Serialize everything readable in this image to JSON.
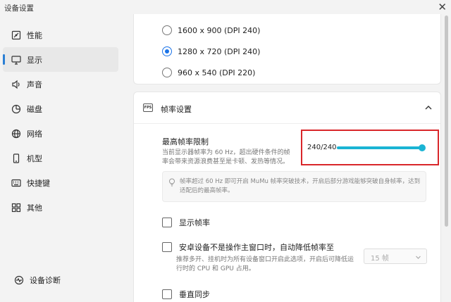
{
  "window": {
    "title": "设备设置",
    "close_glyph": "✕"
  },
  "sidebar": {
    "items": [
      {
        "label": "性能",
        "icon": "speedometer-icon",
        "active": false
      },
      {
        "label": "显示",
        "icon": "monitor-icon",
        "active": true
      },
      {
        "label": "声音",
        "icon": "speaker-icon",
        "active": false
      },
      {
        "label": "磁盘",
        "icon": "disk-icon",
        "active": false
      },
      {
        "label": "网络",
        "icon": "globe-icon",
        "active": false
      },
      {
        "label": "机型",
        "icon": "phone-icon",
        "active": false
      },
      {
        "label": "快捷键",
        "icon": "keyboard-icon",
        "active": false
      },
      {
        "label": "其他",
        "icon": "grid-icon",
        "active": false
      }
    ],
    "diagnostics": {
      "label": "设备诊断",
      "icon": "diagnostics-icon"
    }
  },
  "resolution": {
    "options": [
      {
        "label": "1600 x 900 (DPI 240)",
        "checked": false
      },
      {
        "label": "1280 x 720 (DPI 240)",
        "checked": true
      },
      {
        "label": "960 x 540 (DPI 220)",
        "checked": false
      }
    ]
  },
  "framerate": {
    "section_title": "帧率设置",
    "fps_icon_text": "FPS",
    "max_limit": {
      "title": "最高帧率限制",
      "description": "当前显示器帧率为 60 Hz，超出硬件条件的帧率会带来资源浪费甚至是卡顿、发热等情况。",
      "value_text": "240/240",
      "slider_fraction": 1.0
    },
    "tip": "帧率超过 60 Hz 即可开启 MuMu 帧率突破技术，开启后部分游戏能够突破自身帧率，达到适配后的最高帧率。",
    "show_fps": {
      "label": "显示帧率",
      "checked": false
    },
    "background_reduce": {
      "label": "安卓设备不是操作主窗口时，自动降低帧率至",
      "checked": false,
      "description": "推荐多开、挂机时为所有设备窗口开启此选项，开启后可降低运行时的 CPU 和 GPU 占用。",
      "select_value": "15 帧",
      "disabled": true
    },
    "vsync": {
      "label": "垂直同步",
      "checked": false
    }
  },
  "colors": {
    "accent": "#1a73e8",
    "slider": "#1ab4d4",
    "highlight_border": "#d9262a"
  }
}
